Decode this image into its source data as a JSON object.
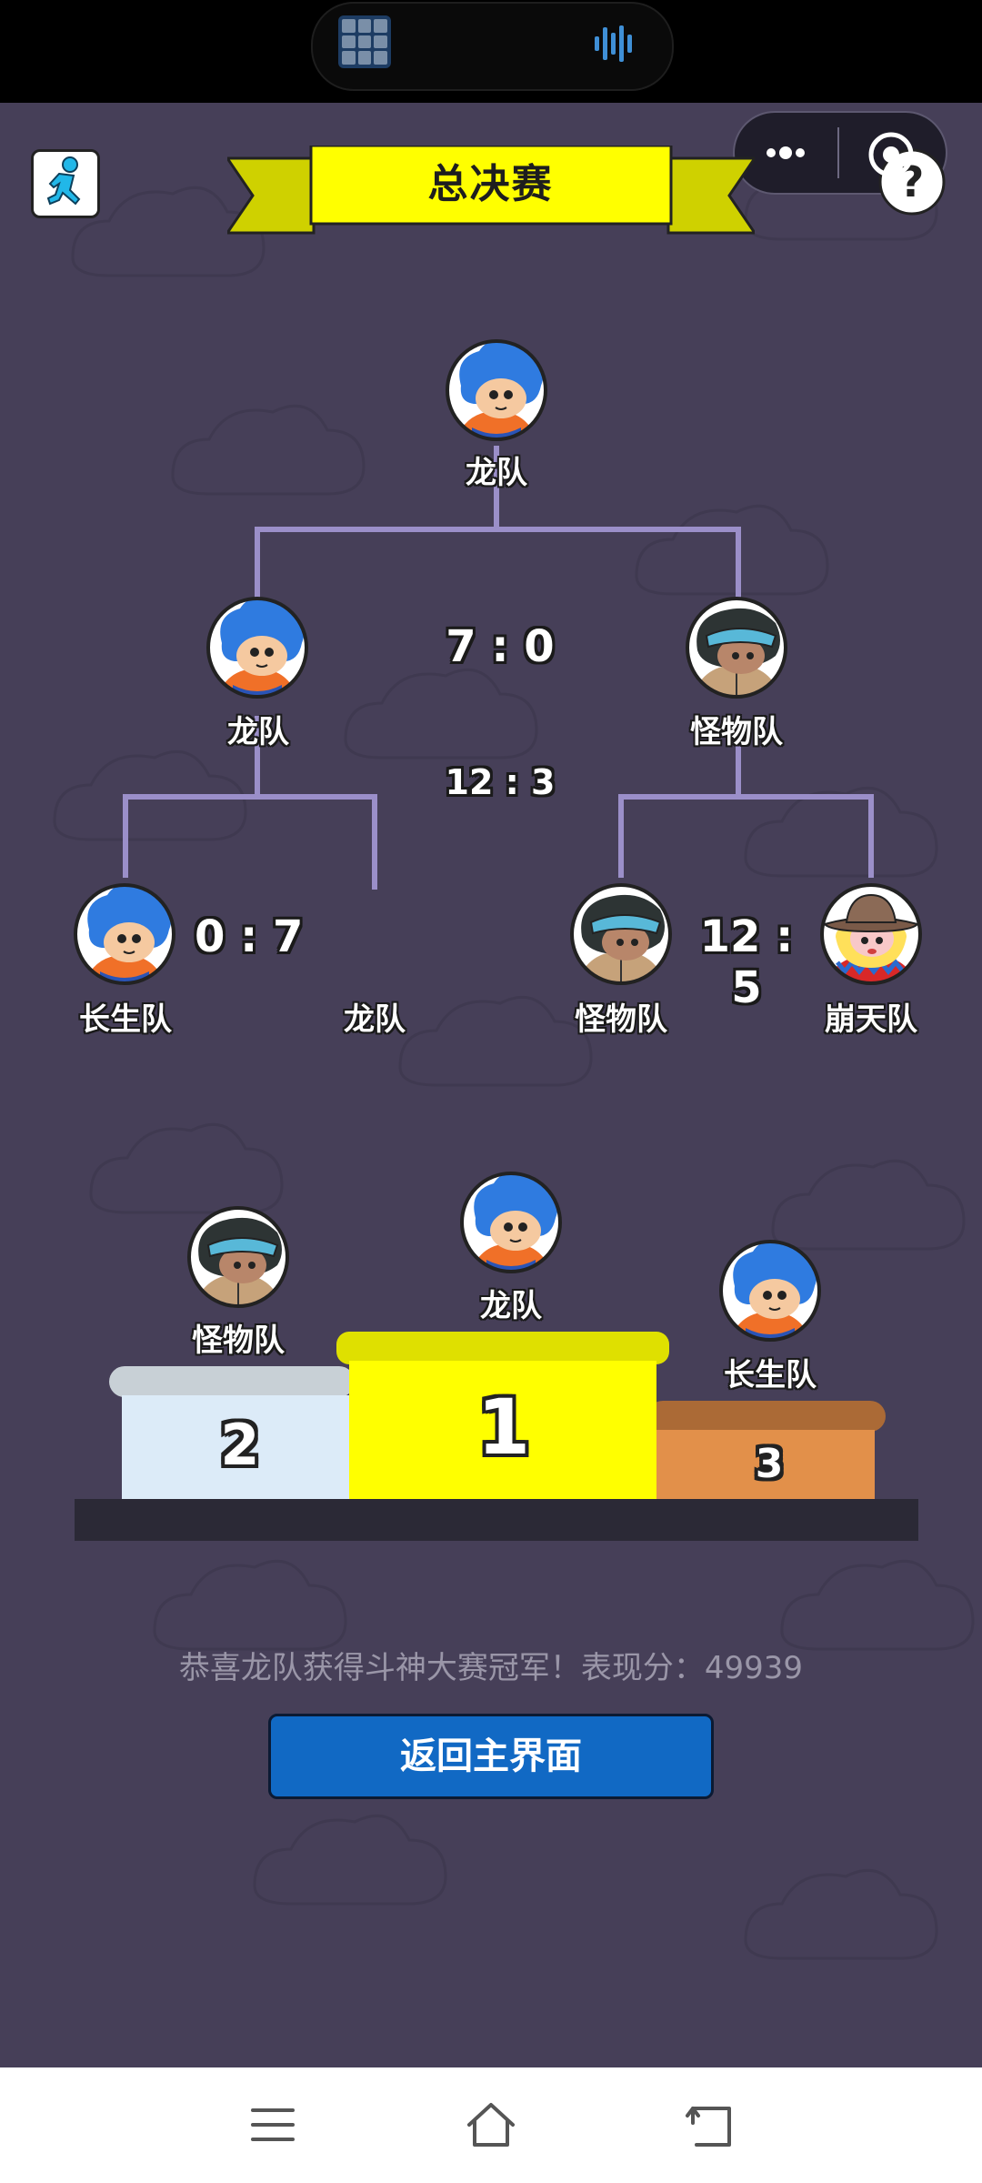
{
  "banner": {
    "title": "总决赛"
  },
  "bracket": {
    "champion": {
      "name": "龙队"
    },
    "semifinal_left": {
      "name": "龙队"
    },
    "semifinal_right": {
      "name": "怪物队"
    },
    "final_score": "7 : 0",
    "semifinal_score": "12 : 3",
    "round1": [
      {
        "name": "长生队",
        "score": "0 : 7"
      },
      {
        "name": "龙队"
      },
      {
        "name": "怪物队",
        "score": "12 : 5"
      },
      {
        "name": "崩天队"
      }
    ]
  },
  "podium": {
    "first": {
      "rank": "1",
      "name": "龙队"
    },
    "second": {
      "rank": "2",
      "name": "怪物队"
    },
    "third": {
      "rank": "3",
      "name": "长生队"
    }
  },
  "result_message": "恭喜龙队获得斗神大赛冠军！表现分：49939",
  "return_button_label": "返回主界面",
  "colors": {
    "background": "#463f58",
    "bracket_line": "#9b8fc9",
    "banner_yellow": "#ffff00",
    "button_blue": "#1169c4",
    "podium_first": "#ffff00",
    "podium_second": "#dcebf8",
    "podium_third": "#e2904a"
  },
  "icons": [
    "run-icon",
    "more-icon",
    "target-icon",
    "help-icon",
    "menu-icon",
    "home-icon",
    "back-icon"
  ]
}
